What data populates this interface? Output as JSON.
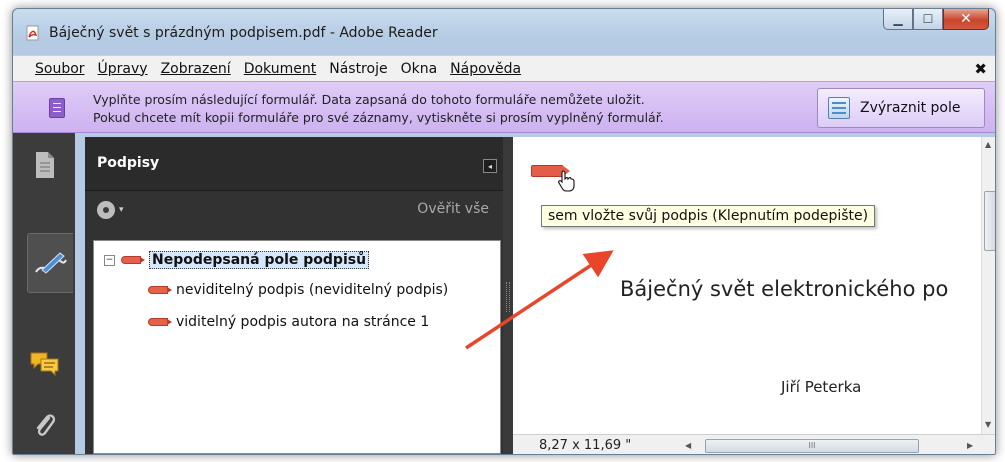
{
  "window": {
    "title": "Báječný svět s prázdným podpisem.pdf - Adobe Reader",
    "minimize_glyph": "▁",
    "maximize_glyph": "☐",
    "close_glyph": "✕"
  },
  "menu": {
    "items": [
      "Soubor",
      "Úpravy",
      "Zobrazení",
      "Dokument",
      "Nástroje",
      "Okna",
      "Nápověda"
    ],
    "close_glyph": "✖"
  },
  "form_bar": {
    "message_line1": "Vyplňte prosím následující formulář. Data zapsaná do tohoto formuláře nemůžete uložit.",
    "message_line2": "Pokud chcete mít kopii formuláře pro své záznamy, vytiskněte si prosím vyplněný formulář.",
    "highlight_button": "Zvýraznit pole"
  },
  "signatures_panel": {
    "title": "Podpisy",
    "collapse_glyph": "◂",
    "options_caret": "▾",
    "verify_all": "Ověřit vše",
    "tree": {
      "group_expander": "−",
      "group_label": "Nepodepsaná pole podpisů",
      "items": [
        "neviditelný podpis (neviditelný podpis)",
        "viditelný podpis autora na stránce 1"
      ]
    }
  },
  "document": {
    "tooltip": "sem vložte svůj podpis (Klepnutím podepište)",
    "heading": "Báječný svět elektronického po",
    "author": "Jiří Peterka",
    "page_size": "8,27 x 11,69 \""
  },
  "scrollbars": {
    "up_glyph": "▲",
    "down_glyph": "▼",
    "left_glyph": "◀",
    "right_glyph": "▶",
    "thumb_grip": "III"
  },
  "colors": {
    "form_bar": "#cdb2f0",
    "toolstrip": "#3c3c3c",
    "signature_field": "#e35d48",
    "annotation_arrow": "#e8452b",
    "tooltip_bg": "#ffffe1"
  },
  "icons": {
    "app": "pdf-icon",
    "form": "form-icon",
    "highlight": "highlight-fields-icon",
    "pages": "page-thumbnails-icon",
    "signatures": "signature-pen-icon",
    "comments": "comments-icon",
    "attachments": "paperclip-icon",
    "options": "gear-icon",
    "pointer": "hand-cursor-icon"
  }
}
